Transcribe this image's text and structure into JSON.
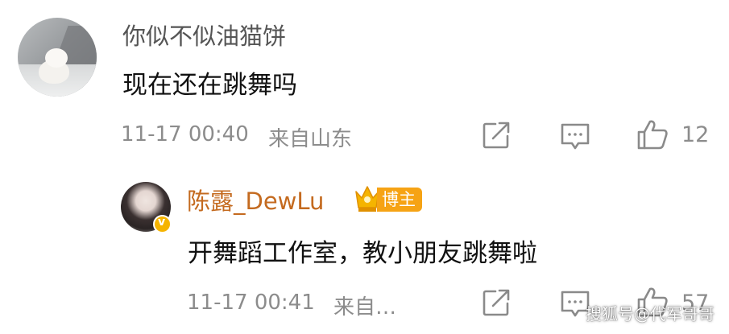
{
  "comment": {
    "username": "你似不似油猫饼",
    "text": "现在还在跳舞吗",
    "time": "11-17 00:40",
    "location": "来自山东",
    "like_count": "12",
    "icons": [
      "share-icon",
      "reply-icon",
      "like-icon"
    ]
  },
  "reply": {
    "username": "陈露_DewLu",
    "badge": "博主",
    "text": "开舞蹈工作室，教小朋友跳舞啦",
    "time": "11-17 00:41",
    "location": "来自…",
    "like_count": "57",
    "verified_mark": "v"
  },
  "watermark": "搜狐号@代军哥哥",
  "colors": {
    "badge": "#f6a314",
    "crown": "#f5b400",
    "meta": "#8c8c8c",
    "icon": "#8a8a8a"
  }
}
